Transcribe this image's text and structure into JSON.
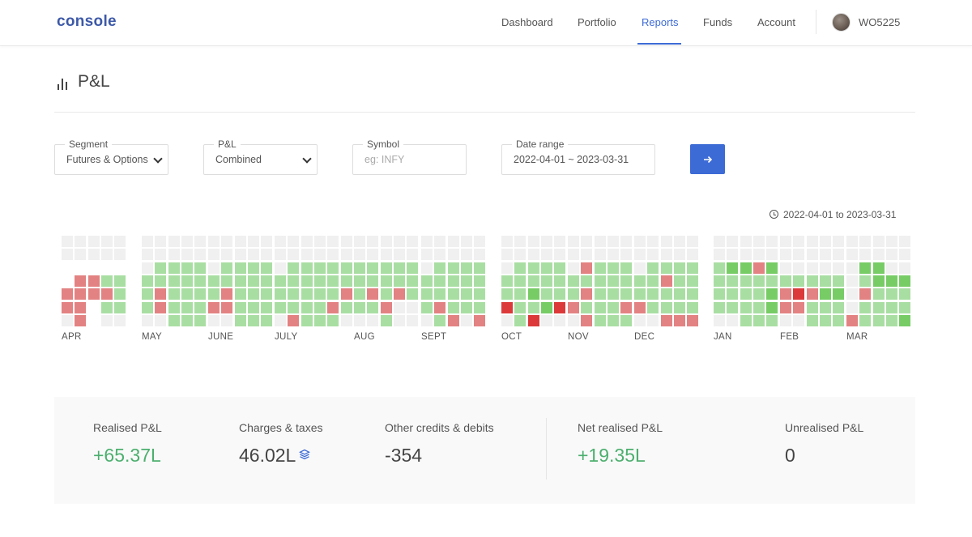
{
  "app": {
    "logo": "console",
    "user_id": "WO5225"
  },
  "nav": [
    {
      "label": "Dashboard",
      "active": false
    },
    {
      "label": "Portfolio",
      "active": false
    },
    {
      "label": "Reports",
      "active": true
    },
    {
      "label": "Funds",
      "active": false
    },
    {
      "label": "Account",
      "active": false
    }
  ],
  "page": {
    "title": "P&L"
  },
  "filters": {
    "segment": {
      "label": "Segment",
      "value": "Futures & Options"
    },
    "pnl": {
      "label": "P&L",
      "value": "Combined"
    },
    "symbol": {
      "label": "Symbol",
      "placeholder": "eg: INFY"
    },
    "date_range": {
      "label": "Date range",
      "value": "2022-04-01 ~ 2023-03-31"
    },
    "go_icon": "arrow-right-icon"
  },
  "range_note": "2022-04-01 to 2023-03-31",
  "colors": {
    "empty": "#f0f0f0",
    "profit_light": "#a9dea3",
    "profit_strong": "#77cc66",
    "loss_light": "#e38282",
    "loss_strong": "#dc3a3a",
    "accent": "#3d6bd6",
    "positive_text": "#4caf6e"
  },
  "heatmap": {
    "legend_codes": {
      "0": "empty",
      "1": "profit_light",
      "2": "profit_strong",
      "3": "loss_light",
      "4": "loss_strong",
      "5": "blank"
    },
    "months": [
      {
        "label": "APR",
        "weeks": [
          "0055330",
          "0053333",
          "0053355",
          "0051310",
          "0051110"
        ]
      },
      {
        "label": "MAY",
        "weeks": [
          "0001110",
          "0011330",
          "0011111",
          "0011111",
          "0011111",
          "0033330",
          "0033110"
        ]
      },
      {
        "label": "JUNE",
        "weeks": [
          "0001130",
          "0011330",
          "0011111",
          "0011111",
          "0011111",
          "0011310",
          "0011110"
        ]
      },
      {
        "label": "JULY",
        "weeks": [
          "0001110",
          "0011113",
          "0011111",
          "0011111",
          "0011131",
          "0011310",
          "0011110"
        ]
      },
      {
        "label": "AUG",
        "weeks": [
          "0011110",
          "0011310",
          "0011131",
          "0011300",
          "0011100"
        ]
      },
      {
        "label": "SEPT",
        "weeks": [
          "0001110",
          "0011131",
          "0011113",
          "0011110",
          "0011113"
        ]
      },
      {
        "label": "OCT",
        "weeks": [
          "0001140",
          "0011111",
          "0011214",
          "0011120",
          "0011140"
        ]
      },
      {
        "label": "NOV",
        "weeks": [
          "0001130",
          "0031313",
          "0011111",
          "0011111",
          "0011131",
          "0011113"
        ]
      },
      {
        "label": "DEC",
        "weeks": [
          "0001130",
          "0011110",
          "0013113",
          "0011113",
          "0011113"
        ]
      },
      {
        "label": "JAN",
        "weeks": [
          "0011110",
          "0021110",
          "0021111",
          "0031111",
          "0021221",
          "0021212",
          "0011100"
        ]
      },
      {
        "label": "FEB",
        "weeks": [
          "0001330",
          "0001430",
          "0001311",
          "0001211",
          "0001211"
        ]
      },
      {
        "label": "MAR",
        "weeks": [
          "0000003",
          "0021311",
          "0022111",
          "0002111",
          "0002112"
        ]
      }
    ]
  },
  "summary": {
    "realised": {
      "label": "Realised P&L",
      "value": "+65.37L"
    },
    "charges": {
      "label": "Charges & taxes",
      "value": "46.02L",
      "icon": "layers-icon"
    },
    "other": {
      "label": "Other credits & debits",
      "value": "-354"
    },
    "net": {
      "label": "Net realised P&L",
      "value": "+19.35L"
    },
    "unrealised": {
      "label": "Unrealised P&L",
      "value": "0"
    }
  }
}
